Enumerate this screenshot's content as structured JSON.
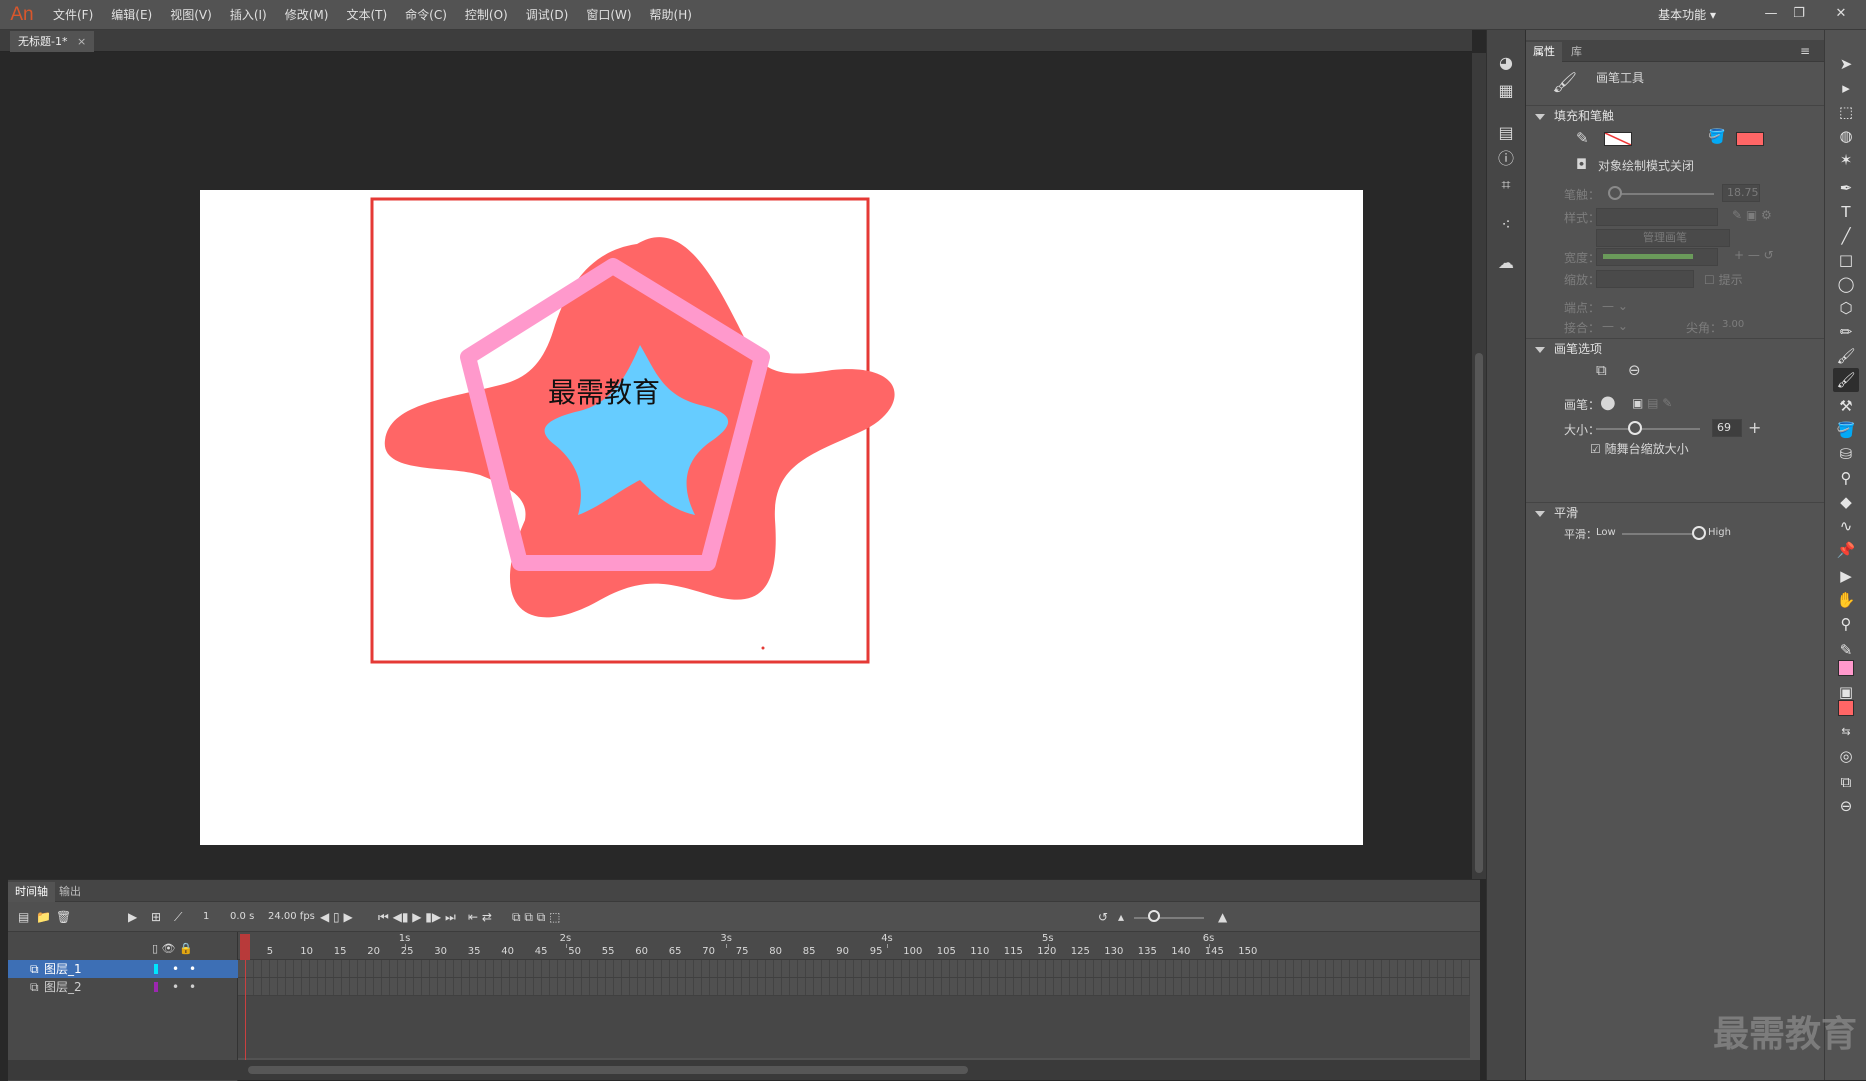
{
  "app": {
    "logo": "An",
    "menus": [
      "文件(F)",
      "编辑(E)",
      "视图(V)",
      "插入(I)",
      "修改(M)",
      "文本(T)",
      "命令(C)",
      "控制(O)",
      "调试(D)",
      "窗口(W)",
      "帮助(H)"
    ],
    "workspace": "基本功能",
    "workspace_arrow": "▾",
    "minimize": "—",
    "restore": "❐",
    "close": "✕"
  },
  "document": {
    "tab_title": "无标题-1*",
    "tab_close": "×",
    "stage_text": "最需教育",
    "colors": {
      "star_fill": "#FF6666",
      "inner_star": "#66CCFF",
      "pentagon_stroke": "#FF99CC",
      "selection_box": "#E53935",
      "stage_bg": "#FFFFFF"
    }
  },
  "properties": {
    "tabs": [
      "属性",
      "库"
    ],
    "tool_name": "画笔工具",
    "fill_stroke": {
      "header": "填充和笔触",
      "object_draw_mode": "对象绘制模式关闭",
      "fill_color": "#FF6666"
    },
    "stroke_label": "笔触：",
    "stroke_value": "18.75",
    "style_label": "样式：",
    "manage_brush": "管理画笔",
    "width_label": "宽度：",
    "scale_label": "缩放：",
    "hint_label": "提示",
    "cap_label": "端点：",
    "join_label": "接合：",
    "miter_label": "尖角：",
    "miter_value": "3.00",
    "brush_options": {
      "header": "画笔选项",
      "brush_label": "画笔：",
      "size_label": "大小：",
      "size_value": "69",
      "size_plus": "+",
      "scale_with_stage": "随舞台缩放大小"
    },
    "smoothing": {
      "header": "平滑",
      "label": "平滑：",
      "low": "Low",
      "high": "High"
    }
  },
  "timeline": {
    "tabs": [
      "时间轴",
      "输出"
    ],
    "frame_number": "1",
    "time": "0.0 s",
    "fps": "24.00 fps",
    "seconds": [
      "1s",
      "2s",
      "3s",
      "4s",
      "5s",
      "6s"
    ],
    "frame_labels": [
      "1",
      "5",
      "10",
      "15",
      "20",
      "25",
      "30",
      "35",
      "40",
      "45",
      "50",
      "55",
      "60",
      "65",
      "70",
      "75",
      "80",
      "85",
      "90",
      "95",
      "100",
      "105",
      "110",
      "115",
      "120",
      "125",
      "130",
      "135",
      "140",
      "145",
      "150"
    ],
    "layers": [
      {
        "name": "图层_1",
        "color": "#00E5FF",
        "selected": true
      },
      {
        "name": "图层_2",
        "color": "#9C27B0",
        "selected": false
      }
    ]
  },
  "watermark": "最需教育"
}
